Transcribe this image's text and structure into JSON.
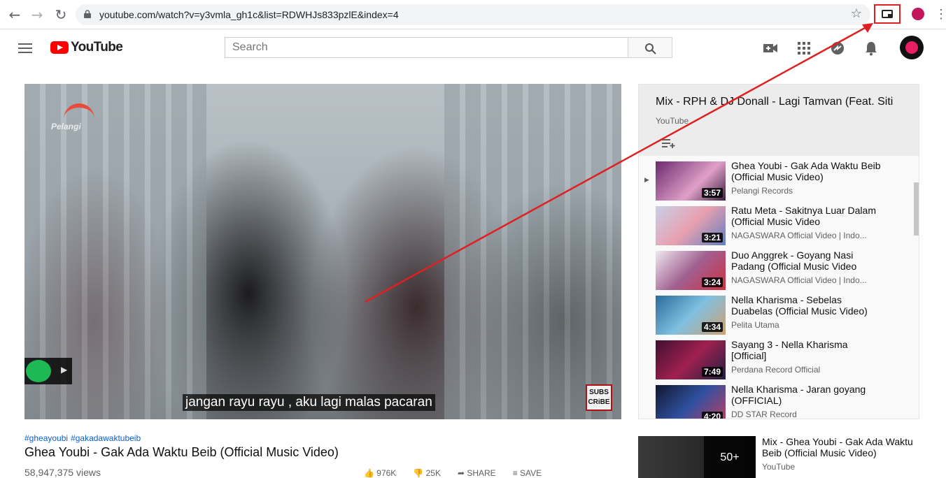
{
  "browser": {
    "url": "youtube.com/watch?v=y3vmla_gh1c&list=RDWHJs833pzlE&index=4",
    "back_icon": "arrow-left",
    "forward_icon": "arrow-right",
    "reload_icon": "reload",
    "lock_icon": "lock",
    "bookmark_icon": "star",
    "pip_icon": "picture-in-picture",
    "menu_icon": "vertical-dots",
    "highlight_color": "#e02020"
  },
  "header": {
    "logo_text": "YouTube",
    "search_placeholder": "Search",
    "icons": [
      "hamburger-icon",
      "search-icon",
      "create-video-icon",
      "apps-grid-icon",
      "share-icon",
      "bell-icon"
    ],
    "brand_color": "#ff0000"
  },
  "player": {
    "watermark": "Pelangi",
    "caption": "jangan rayu rayu , aku lagi malas pacaran",
    "subscribe_badge_line1": "SUBS",
    "subscribe_badge_line2": "CRiBE"
  },
  "video": {
    "hashtags": [
      "#gheayoubi",
      "#gakadawaktubeib"
    ],
    "title": "Ghea Youbi - Gak Ada Waktu Beib (Official Music Video)",
    "views": "58,947,375 views",
    "likes": "976K",
    "dislikes": "25K",
    "share_label": "SHARE",
    "save_label": "SAVE"
  },
  "playlist": {
    "title": "Mix - RPH & DJ Donall - Lagi Tamvan (Feat. Siti",
    "channel": "YouTube",
    "playing_indicator": "▶",
    "items": [
      {
        "title": "Ghea Youbi - Gak Ada Waktu Beib (Official Music Video)",
        "channel": "Pelangi Records",
        "duration": "3:57"
      },
      {
        "title": "Ratu Meta - Sakitnya Luar Dalam (Official Music Video",
        "channel": "NAGASWARA Official Video | Indo...",
        "duration": "3:21"
      },
      {
        "title": "Duo Anggrek - Goyang Nasi Padang (Official Music Video",
        "channel": "NAGASWARA Official Video | Indo...",
        "duration": "3:24"
      },
      {
        "title": "Nella Kharisma - Sebelas Duabelas (Official Music Video)",
        "channel": "Pelita Utama",
        "duration": "4:34"
      },
      {
        "title": "Sayang 3 - Nella Kharisma [Official]",
        "channel": "Perdana Record Official",
        "duration": "7:49"
      },
      {
        "title": "Nella Kharisma - Jaran goyang (OFFICIAL)",
        "channel": "DD STAR Record",
        "duration": "4:20"
      }
    ]
  },
  "mix_card": {
    "title": "Mix - Ghea Youbi - Gak Ada Waktu Beib (Official Music Video)",
    "channel": "YouTube",
    "count": "50+"
  }
}
